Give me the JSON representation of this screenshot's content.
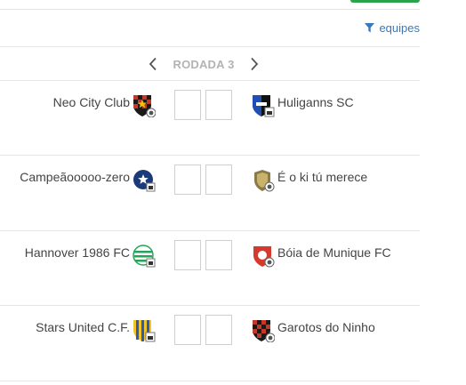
{
  "header": {
    "filter_label": "equipes",
    "accent_color": "#2aa44a",
    "link_color": "#3b78b8"
  },
  "round": {
    "label": "RODADA 3",
    "prev_icon": "chevron-left-icon",
    "next_icon": "chevron-right-icon"
  },
  "matches": [
    {
      "home": "Neo City Club",
      "home_crest": "crest-red-black-checkered",
      "away": "Huliganns SC",
      "away_crest": "crest-black-blue",
      "home_score": "",
      "away_score": ""
    },
    {
      "home": "Campeãooooo-zero",
      "home_crest": "crest-navy-star",
      "away": "É o ki tú merece",
      "away_crest": "crest-gold-shield",
      "home_score": "",
      "away_score": ""
    },
    {
      "home": "Hannover 1986 FC",
      "home_crest": "crest-green-white-stripes",
      "away": "Bóia de Munique FC",
      "away_crest": "crest-red-white",
      "home_score": "",
      "away_score": ""
    },
    {
      "home": "Stars United C.F.",
      "home_crest": "crest-blue-yellow",
      "away": "Garotos do Ninho",
      "away_crest": "crest-red-black-checkered",
      "home_score": "",
      "away_score": ""
    }
  ]
}
